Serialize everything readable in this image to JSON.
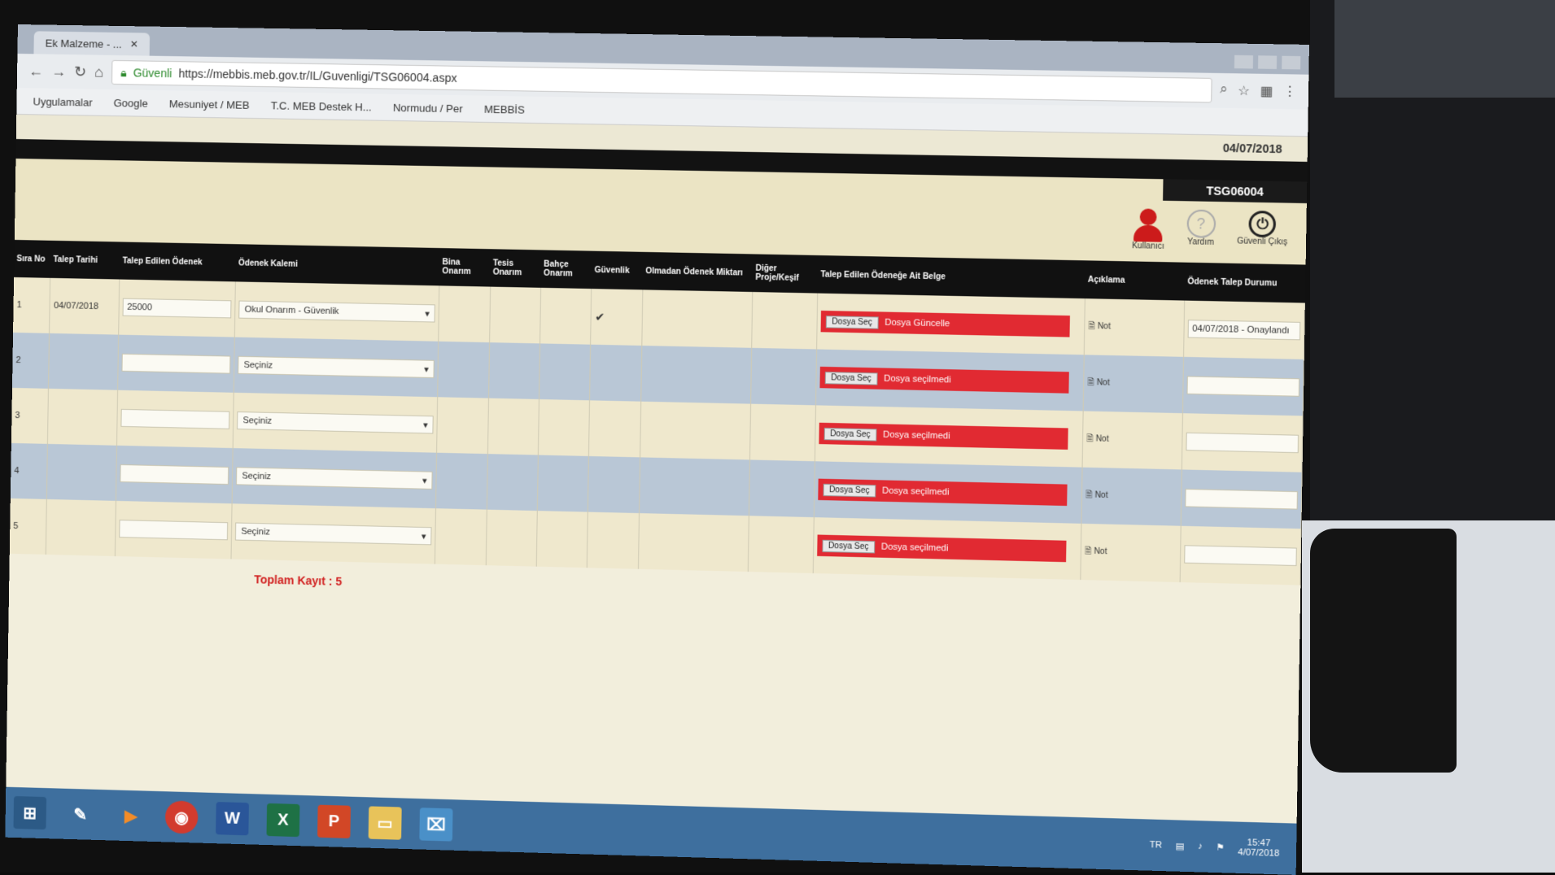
{
  "browser": {
    "tab_title": "Ek Malzeme - ...",
    "url_secure_label": "Güvenli",
    "url": "https://mebbis.meb.gov.tr/IL/Guvenligi/TSG06004.aspx",
    "bookmarks": [
      "Uygulamalar",
      "Google",
      "Mesuniyet / MEB",
      "T.C. MEB Destek H...",
      "Normudu / Per",
      "MEBBİS"
    ]
  },
  "app": {
    "date": "04/07/2018",
    "user_id": "TSG06004",
    "icons": {
      "user_label": "Kullanıcı",
      "help_label": "Yardım",
      "logout_label": "Güvenli Çıkış"
    }
  },
  "table": {
    "headers": [
      "Sıra No",
      "Talep Tarihi",
      "Talep Edilen Ödenek",
      "Ödenek Kalemi",
      "Bina Onarım",
      "Tesis Onarım",
      "Bahçe Onarım",
      "Güvenlik",
      "Olmadan Ödenek Miktarı",
      "Diğer Proje/Keşif",
      "Talep Edilen Ödeneğe Ait Belge",
      "Açıklama",
      "Ödenek Talep Durumu"
    ],
    "rows": [
      {
        "no": "1",
        "date": "04/07/2018",
        "amount": "25000",
        "item": "Okul Onarım - Güvenlik",
        "file_btn": "Dosya Seç",
        "file_status": "Dosya Güncelle",
        "note_icon": "Not",
        "status_value": "04/07/2018 - Onaylandı"
      },
      {
        "no": "2",
        "date": "",
        "amount": "",
        "item": "Seçiniz",
        "file_btn": "Dosya Seç",
        "file_status": "Dosya seçilmedi",
        "note_icon": "Not",
        "status_value": ""
      },
      {
        "no": "3",
        "date": "",
        "amount": "",
        "item": "Seçiniz",
        "file_btn": "Dosya Seç",
        "file_status": "Dosya seçilmedi",
        "note_icon": "Not",
        "status_value": ""
      },
      {
        "no": "4",
        "date": "",
        "amount": "",
        "item": "Seçiniz",
        "file_btn": "Dosya Seç",
        "file_status": "Dosya seçilmedi",
        "note_icon": "Not",
        "status_value": ""
      },
      {
        "no": "5",
        "date": "",
        "amount": "",
        "item": "Seçiniz",
        "file_btn": "Dosya Seç",
        "file_status": "Dosya seçilmedi",
        "note_icon": "Not",
        "status_value": ""
      }
    ],
    "total_label": "Toplam Kayıt : 5"
  },
  "taskbar": {
    "items": [
      "start-icon",
      "pen-icon",
      "media-icon",
      "chrome-icon",
      "word-icon",
      "excel-icon",
      "powerpoint-icon",
      "folder-icon",
      "network-icon"
    ],
    "time": "15:47",
    "date": "4/07/2018"
  },
  "colors": {
    "header_bg": "#111111",
    "row_light": "#efe8cd",
    "row_blue": "#b9c7d6",
    "upload_red": "#e12a32",
    "brand_red": "#cc1b1b"
  }
}
